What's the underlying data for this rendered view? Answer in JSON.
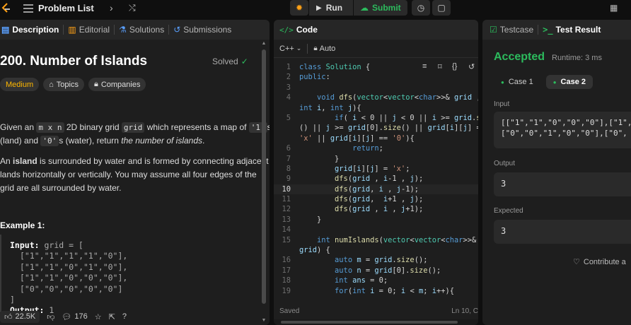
{
  "topbar": {
    "problem_list": "Problem List",
    "run": "Run",
    "submit": "Submit"
  },
  "left": {
    "tabs": [
      "Description",
      "Editorial",
      "Solutions",
      "Submissions"
    ],
    "title": "200. Number of Islands",
    "solved": "Solved",
    "tags": {
      "difficulty": "Medium",
      "topics": "Topics",
      "companies": "Companies"
    },
    "desc": {
      "p1_a": "Given an ",
      "p1_b": "m x n",
      "p1_c": " 2D binary grid ",
      "p1_d": "grid",
      "p1_e": " which represents a map of ",
      "p1_f": "'1'",
      "p1_g": "s",
      "p1_h": "(land) and ",
      "p1_i": "'0'",
      "p1_j": "s (water), return ",
      "p1_k": "the number of islands",
      "p1_l": ".",
      "p2_a": "An ",
      "p2_b": "island",
      "p2_c": " is surrounded by water and is formed by connecting adjacent",
      "p2_d": "lands horizontally or vertically. You may assume all four edges of the",
      "p2_e": "grid are all surrounded by water."
    },
    "example_title": "Example 1:",
    "example": {
      "input_label": "Input:",
      "input_head": " grid = [",
      "rows": [
        "[\"1\",\"1\",\"1\",\"1\",\"0\"],",
        "[\"1\",\"1\",\"0\",\"1\",\"0\"],",
        "[\"1\",\"1\",\"0\",\"0\",\"0\"],",
        "[\"0\",\"0\",\"0\",\"0\",\"0\"]"
      ],
      "close": "]",
      "output_label": "Output:",
      "output_value": " 1"
    },
    "footer": {
      "likes": "22.5K",
      "comments": "176"
    }
  },
  "code": {
    "header": "Code",
    "language": "C++",
    "auto": "Auto",
    "status": "Saved",
    "position": "Ln 10, C"
  },
  "result": {
    "tabs": [
      "Testcase",
      "Test Result"
    ],
    "verdict": "Accepted",
    "runtime": "Runtime: 3 ms",
    "cases": [
      "Case 1",
      "Case 2"
    ],
    "input_label": "Input",
    "input_lines": [
      "[[\"1\",\"1\",\"0\",\"0\",\"0\"],[\"1\",",
      "[\"0\",\"0\",\"1\",\"0\",\"0\"],[\"0\","
    ],
    "output_label": "Output",
    "output_value": "3",
    "expected_label": "Expected",
    "expected_value": "3",
    "contribute": "Contribute a"
  },
  "colors": {
    "accent_green": "#2cbb5d",
    "medium": "#ffb800",
    "link_blue": "#5aa0ff"
  }
}
